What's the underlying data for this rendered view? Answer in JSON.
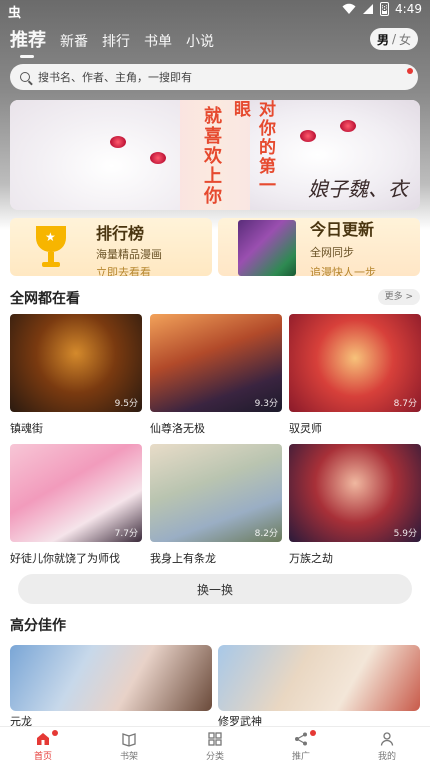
{
  "status_bar": {
    "left_icon": "bug-app-icon",
    "time": "4:49",
    "battery_level": "8"
  },
  "top_nav": {
    "tabs": [
      {
        "label": "推荐",
        "active": true
      },
      {
        "label": "新番",
        "active": false
      },
      {
        "label": "排行",
        "active": false
      },
      {
        "label": "书单",
        "active": false
      },
      {
        "label": "小说",
        "active": false
      }
    ],
    "gender_toggle": {
      "male": "男",
      "separator": "/",
      "female": "女",
      "selected": "男"
    }
  },
  "search": {
    "placeholder": "搜书名、作者、主角，一搜即有"
  },
  "banner": {
    "text_left": "就喜欢上你",
    "text_mid": "对你的第一眼",
    "text_script": "娘子魏、衣"
  },
  "categories": {
    "rank": {
      "title": "排行榜",
      "line1": "海量精品漫画",
      "line2": "立即去看看"
    },
    "update": {
      "title": "今日更新",
      "line1": "全网同步",
      "line2": "追漫快人一步"
    }
  },
  "section_all": {
    "title": "全网都在看",
    "more": "更多 >",
    "items": [
      {
        "name": "镇魂街",
        "score": "9.5分"
      },
      {
        "name": "仙尊洛无极",
        "score": "9.3分"
      },
      {
        "name": "驭灵师",
        "score": "8.7分"
      },
      {
        "name": "好徒儿你就饶了为师伐",
        "score": "7.7分"
      },
      {
        "name": "我身上有条龙",
        "score": "8.2分"
      },
      {
        "name": "万族之劫",
        "score": "5.9分"
      }
    ]
  },
  "swap_label": "换一换",
  "section_top": {
    "title": "高分佳作",
    "items": [
      {
        "name": "元龙"
      },
      {
        "name": "修罗武神"
      }
    ]
  },
  "bottom_nav": [
    {
      "label": "首页",
      "icon": "home-icon",
      "active": true,
      "dot": true
    },
    {
      "label": "书架",
      "icon": "bookshelf-icon",
      "active": false,
      "dot": false
    },
    {
      "label": "分类",
      "icon": "category-icon",
      "active": false,
      "dot": false
    },
    {
      "label": "推广",
      "icon": "share-icon",
      "active": false,
      "dot": true
    },
    {
      "label": "我的",
      "icon": "profile-icon",
      "active": false,
      "dot": false
    }
  ],
  "colors": {
    "accent": "#e53935",
    "score_text": "#ffffff",
    "swap_bg": "#ededed"
  }
}
